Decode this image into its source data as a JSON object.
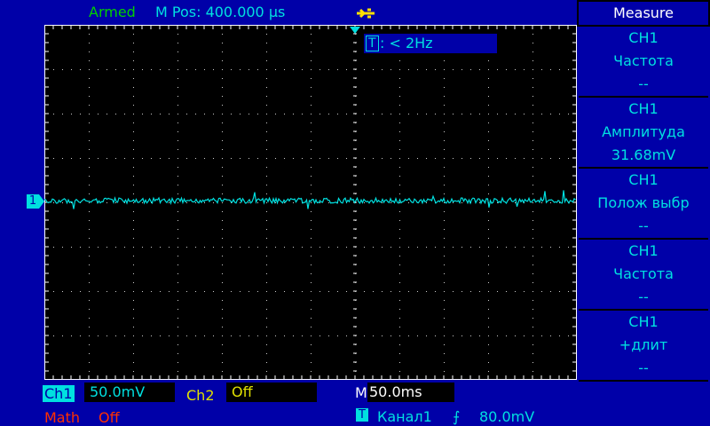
{
  "status": {
    "state": "Armed",
    "mpos": "M Pos: 400.000 µs",
    "usb_icon": "usb-icon"
  },
  "trigger_freq": {
    "label": "T",
    "value": ": < 2Hz"
  },
  "channel_marker": "1",
  "measure": {
    "title": "Measure",
    "items": [
      {
        "ch": "CH1",
        "name": "Частота",
        "value": "--"
      },
      {
        "ch": "CH1",
        "name": "Амплитуда",
        "value": "31.68mV"
      },
      {
        "ch": "CH1",
        "name": "Полож выбр",
        "value": "--"
      },
      {
        "ch": "CH1",
        "name": "Частота",
        "value": "--"
      },
      {
        "ch": "CH1",
        "name": "+длит",
        "value": "--"
      }
    ]
  },
  "bottom": {
    "ch1": "Ch1",
    "ch1_scale": "50.0mV",
    "ch2": "Ch2",
    "ch2_scale": "Off",
    "math": "Math",
    "math_state": "Off",
    "m": "M",
    "timebase": "50.0ms",
    "trig_label": "T",
    "trig_source": "Канал1",
    "trig_edge": "⨍",
    "trig_level": "80.0mV"
  },
  "colors": {
    "ch1": "#00e0e0",
    "ch2": "#e0e000",
    "math": "#ff3000",
    "armed": "#00d000"
  }
}
